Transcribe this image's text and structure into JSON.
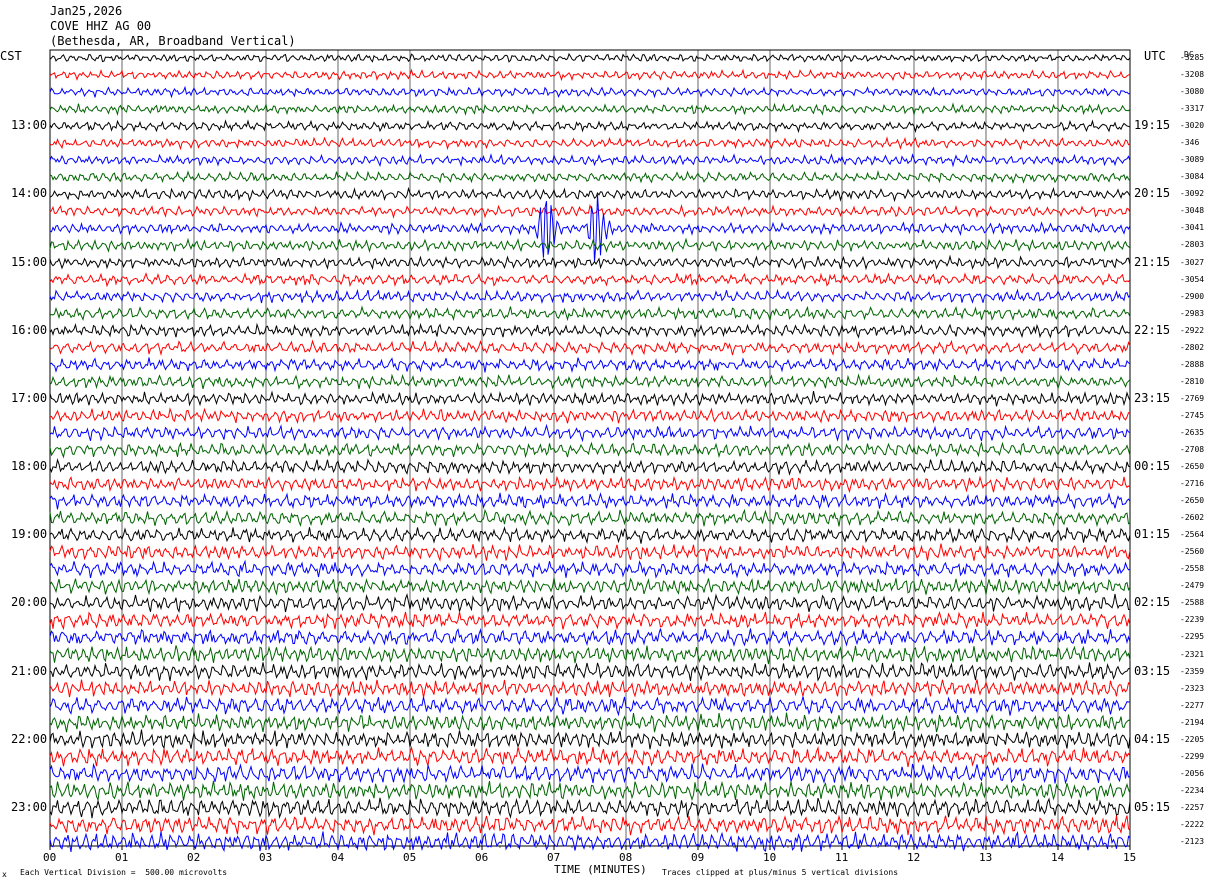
{
  "header": {
    "date": "Jan25,2026",
    "station": "COVE HHZ AG 00",
    "location": "(Bethesda, AR, Broadband Vertical)"
  },
  "left_timezone": "CST",
  "right_timezone": "UTC",
  "dc_label": "DC",
  "footer": {
    "scale_note": "Each Vertical Division =  500.00 microvolts",
    "clip_note": "Traces clipped at plus/minus 5 vertical divisions",
    "corner_mark": "x"
  },
  "colors": {
    "trace_1": "#000000",
    "trace_2": "#ff0000",
    "trace_3": "#0000ff",
    "trace_4": "#006400",
    "grid": "#000000"
  },
  "chart_data": {
    "type": "line",
    "title": "",
    "xlabel": "TIME (MINUTES)",
    "xlim": [
      0,
      15
    ],
    "x_ticks": [
      "00",
      "01",
      "02",
      "03",
      "04",
      "05",
      "06",
      "07",
      "08",
      "09",
      "10",
      "11",
      "12",
      "13",
      "14",
      "15"
    ],
    "left_hour_labels": [
      "13:00",
      "14:00",
      "15:00",
      "16:00",
      "17:00",
      "18:00",
      "19:00",
      "20:00",
      "21:00",
      "22:00",
      "23:00"
    ],
    "right_hour_labels": [
      "19:15",
      "20:15",
      "21:15",
      "22:15",
      "23:15",
      "00:15",
      "01:15",
      "02:15",
      "03:15",
      "04:15",
      "05:15"
    ],
    "trace_interval_minutes": 15,
    "trace_count": 47,
    "trace_color_cycle": [
      "black",
      "red",
      "blue",
      "green"
    ],
    "dc_offsets": [
      -3285,
      -3208,
      -3080,
      -3317,
      -3020,
      -346,
      -3089,
      -3084,
      -3092,
      -3048,
      -3041,
      -2803,
      -3027,
      -3054,
      -2900,
      -2983,
      -2922,
      -2802,
      -2888,
      -2810,
      -2769,
      -2745,
      -2635,
      -2708,
      -2650,
      -2716,
      -2650,
      -2602,
      -2564,
      -2560,
      -2558,
      -2479,
      -2588,
      -2239,
      -2295,
      -2321,
      -2359,
      -2323,
      -2277,
      -2194,
      -2205,
      -2299,
      -2056,
      -2234,
      -2257,
      -2222,
      -2123
    ],
    "events": [
      {
        "trace_index": 10,
        "minute": 6.9,
        "note": "burst"
      },
      {
        "trace_index": 10,
        "minute": 7.6,
        "note": "burst"
      }
    ]
  }
}
